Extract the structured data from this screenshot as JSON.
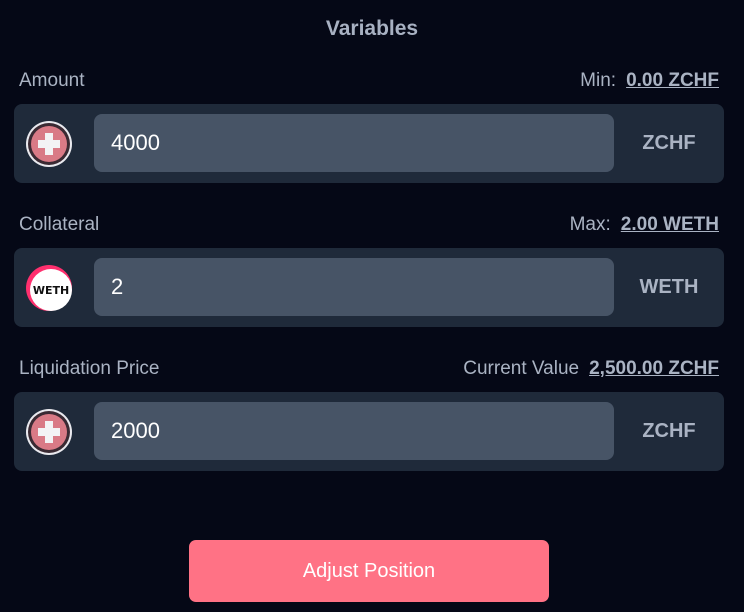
{
  "title": "Variables",
  "fields": [
    {
      "label": "Amount",
      "meta_label": "Min:",
      "meta_value": "0.00 ZCHF",
      "value": "4000",
      "unit": "ZCHF",
      "icon": "swiss-franc-coin-icon"
    },
    {
      "label": "Collateral",
      "meta_label": "Max:",
      "meta_value": "2.00 WETH",
      "value": "2",
      "unit": "WETH",
      "icon": "weth-coin-icon",
      "icon_text": "WETH"
    },
    {
      "label": "Liquidation Price",
      "meta_label": "Current Value",
      "meta_value": "2,500.00 ZCHF",
      "value": "2000",
      "unit": "ZCHF",
      "icon": "swiss-franc-coin-icon"
    }
  ],
  "action": {
    "label": "Adjust Position"
  },
  "colors": {
    "background": "#050816",
    "box": "#1f2a3a",
    "input": "#475466",
    "accent": "#ff7285",
    "text_muted": "#aab3c3"
  }
}
